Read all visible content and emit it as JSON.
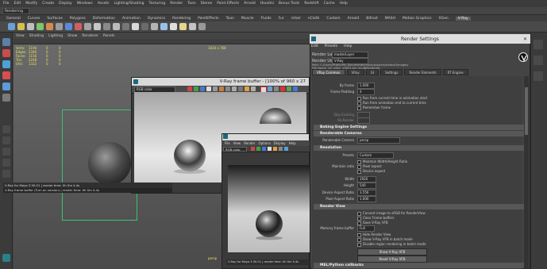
{
  "maya": {
    "workspace": "Rendering",
    "menus": [
      "File",
      "Edit",
      "Modify",
      "Create",
      "Display",
      "Windows",
      "Assets",
      "Lighting/Shading",
      "Texturing",
      "Render",
      "Toon",
      "Stereo",
      "Paint Effects",
      "Arnold",
      "Houdini",
      "Bonus Tools",
      "Redshift",
      "Cache",
      "Help"
    ],
    "shelf_tabs": [
      "General",
      "Curves",
      "Surfaces",
      "Polygons",
      "Deformation",
      "Animation",
      "Dynamics",
      "Rendering",
      "PaintEffects",
      "Toon",
      "Muscle",
      "Fluids",
      "Fur",
      "nHair",
      "nCloth",
      "Custom",
      "Arnold",
      "Bifrost",
      "MASH",
      "Motion Graphics",
      "XGen",
      "V-Ray"
    ],
    "active_shelf_tab": "V-Ray",
    "viewport_menu": [
      "View",
      "Shading",
      "Lighting",
      "Show",
      "Renderer",
      "Panels"
    ],
    "hud_rows": [
      {
        "k": "Verts:",
        "v": "1194",
        "a": "0",
        "b": "0"
      },
      {
        "k": "Edges:",
        "v": "2346",
        "a": "0",
        "b": "0"
      },
      {
        "k": "Faces:",
        "v": "1156",
        "a": "0",
        "b": "0"
      },
      {
        "k": "Tris:",
        "v": "2248",
        "a": "0",
        "b": "0"
      },
      {
        "k": "UVs:",
        "v": "1322",
        "a": "0",
        "b": "0"
      }
    ],
    "hud_label": "1024 x 768",
    "bottom_info": "persp"
  },
  "vfb1": {
    "title": "V-Ray frame buffer - [100% of 960 x 27",
    "channel": "RGB color",
    "status": "V-Ray for Maya 3.50.01 | render time: 0h 0m 4.4s",
    "status2": "V-Ray frame buffer (Turn on version) | render time: 0h 0m 4.4s"
  },
  "vfb2": {
    "menus": [
      "File",
      "View",
      "Render",
      "Options",
      "Display",
      "Help"
    ],
    "channel": "RGB color",
    "status": "V-Ray for Maya 3.50.01 | render time: 0h 0m 5.4s"
  },
  "render_settings": {
    "title": "Render Settings",
    "menus": [
      "Edit",
      "Presets",
      "Help"
    ],
    "render_layer_label": "Render Layer",
    "render_layer_value": "masterLayer",
    "render_using_label": "Render Using",
    "render_using_value": "V-Ray",
    "path_line": "Path: C:/Users/Public/My Documents/maya/projects/default/images/",
    "file_line": "File Name: chi_ptkm_v0001.exr (multiRenderId)",
    "tabs": [
      "VRay Common",
      "VRay",
      "GI",
      "Settings",
      "Render Elements",
      "RT Engine"
    ],
    "active_tab": "VRay Common",
    "fields": {
      "by_frame_label": "By frame",
      "by_frame_value": "1.000",
      "frame_padding_label": "Frame Padding",
      "frame_padding_value": "4",
      "run_current": "Run from current time in animation start",
      "run_current2": "Run from animation end to current time",
      "remember_frame": "Remember frame",
      "skip_existing": "Skip Existing",
      "re_render": "Re-Render"
    },
    "section_baking": "Baking Engine Settings",
    "section_cameras": "Renderable Cameras",
    "renderable_camera_label": "Renderable Camera",
    "renderable_camera_value": "persp",
    "section_resolution": "Resolution",
    "presets_label": "Presets",
    "presets_value": "Custom",
    "maintain_label": "Maintain ratio",
    "maintain_opt1": "Maintain Width/Height Ratio",
    "maintain_opt2": "Pixel aspect",
    "maintain_opt3": "Device aspect",
    "width_label": "Width",
    "width_value": "1920",
    "height_label": "Height",
    "height_value": "540",
    "device_aspect_label": "Device Aspect Ratio",
    "device_aspect_value": "3.556",
    "pixel_aspect_label": "Pixel Aspect Ratio",
    "pixel_aspect_value": "1.000",
    "section_render_view": "Render View",
    "rv_opt1": "Convert image to sRGB for RenderView",
    "rv_opt2": "Clear Frame buffers",
    "rv_opt3": "Save V-Ray VFB",
    "memory_fb_label": "Memory frame buffer",
    "memory_fb_value": "Full",
    "rv_opt4": "Hide Render View",
    "rv_opt5": "Show V-Ray VFB in batch mode",
    "rv_opt6": "Disable region rendering in batch mode",
    "show_vfb_button": "Show V-Ray VFB",
    "reset_vfb_button": "Reset V-Ray VFB",
    "section_mel": "MEL/Python callbacks"
  },
  "colors": {
    "accent": "#3cbf74",
    "highlight_red": "#e03030",
    "hud_yellow": "#e8e060"
  }
}
